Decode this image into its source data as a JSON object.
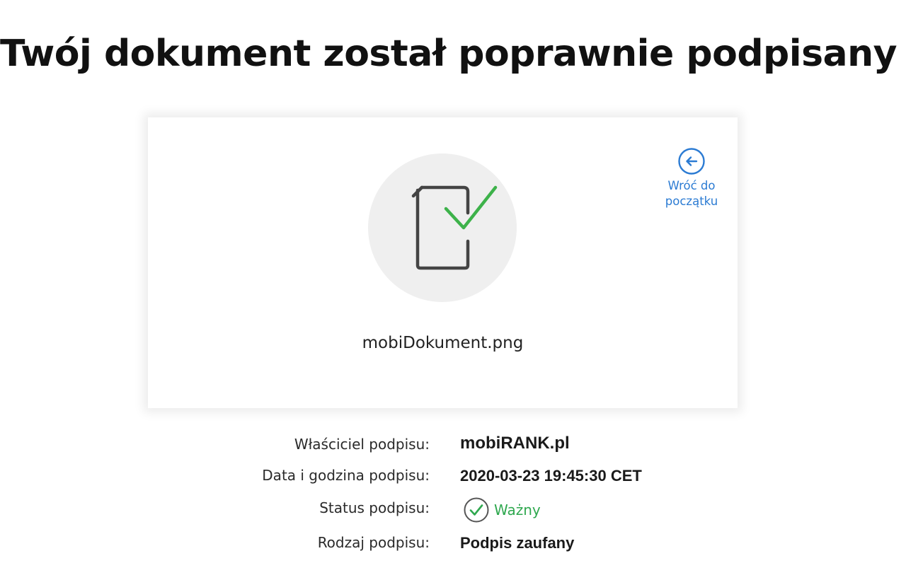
{
  "page": {
    "title": "Twój dokument został poprawnie podpisany"
  },
  "card": {
    "file_name": "mobiDokument.png",
    "document_icon": "signed-document-icon",
    "back": {
      "icon": "arrow-left-circle-icon",
      "label": "Wróć do\npoczątku"
    }
  },
  "details": {
    "owner": {
      "label": "Właściciel podpisu:",
      "value": "mobiRANK.pl"
    },
    "datetime": {
      "label": "Data i godzina podpisu:",
      "value": "2020-03-23 19:45:30 CET"
    },
    "status": {
      "label": "Status podpisu:",
      "value": "Ważny",
      "icon": "check-circle-icon"
    },
    "type": {
      "label": "Rodzaj podpisu:",
      "value": "Podpis zaufany"
    }
  },
  "colors": {
    "accent_blue": "#2b7bd3",
    "success_green": "#2fa84f",
    "check_green": "#3db24a",
    "circle_bg": "#efefef",
    "icon_gray": "#444444"
  }
}
